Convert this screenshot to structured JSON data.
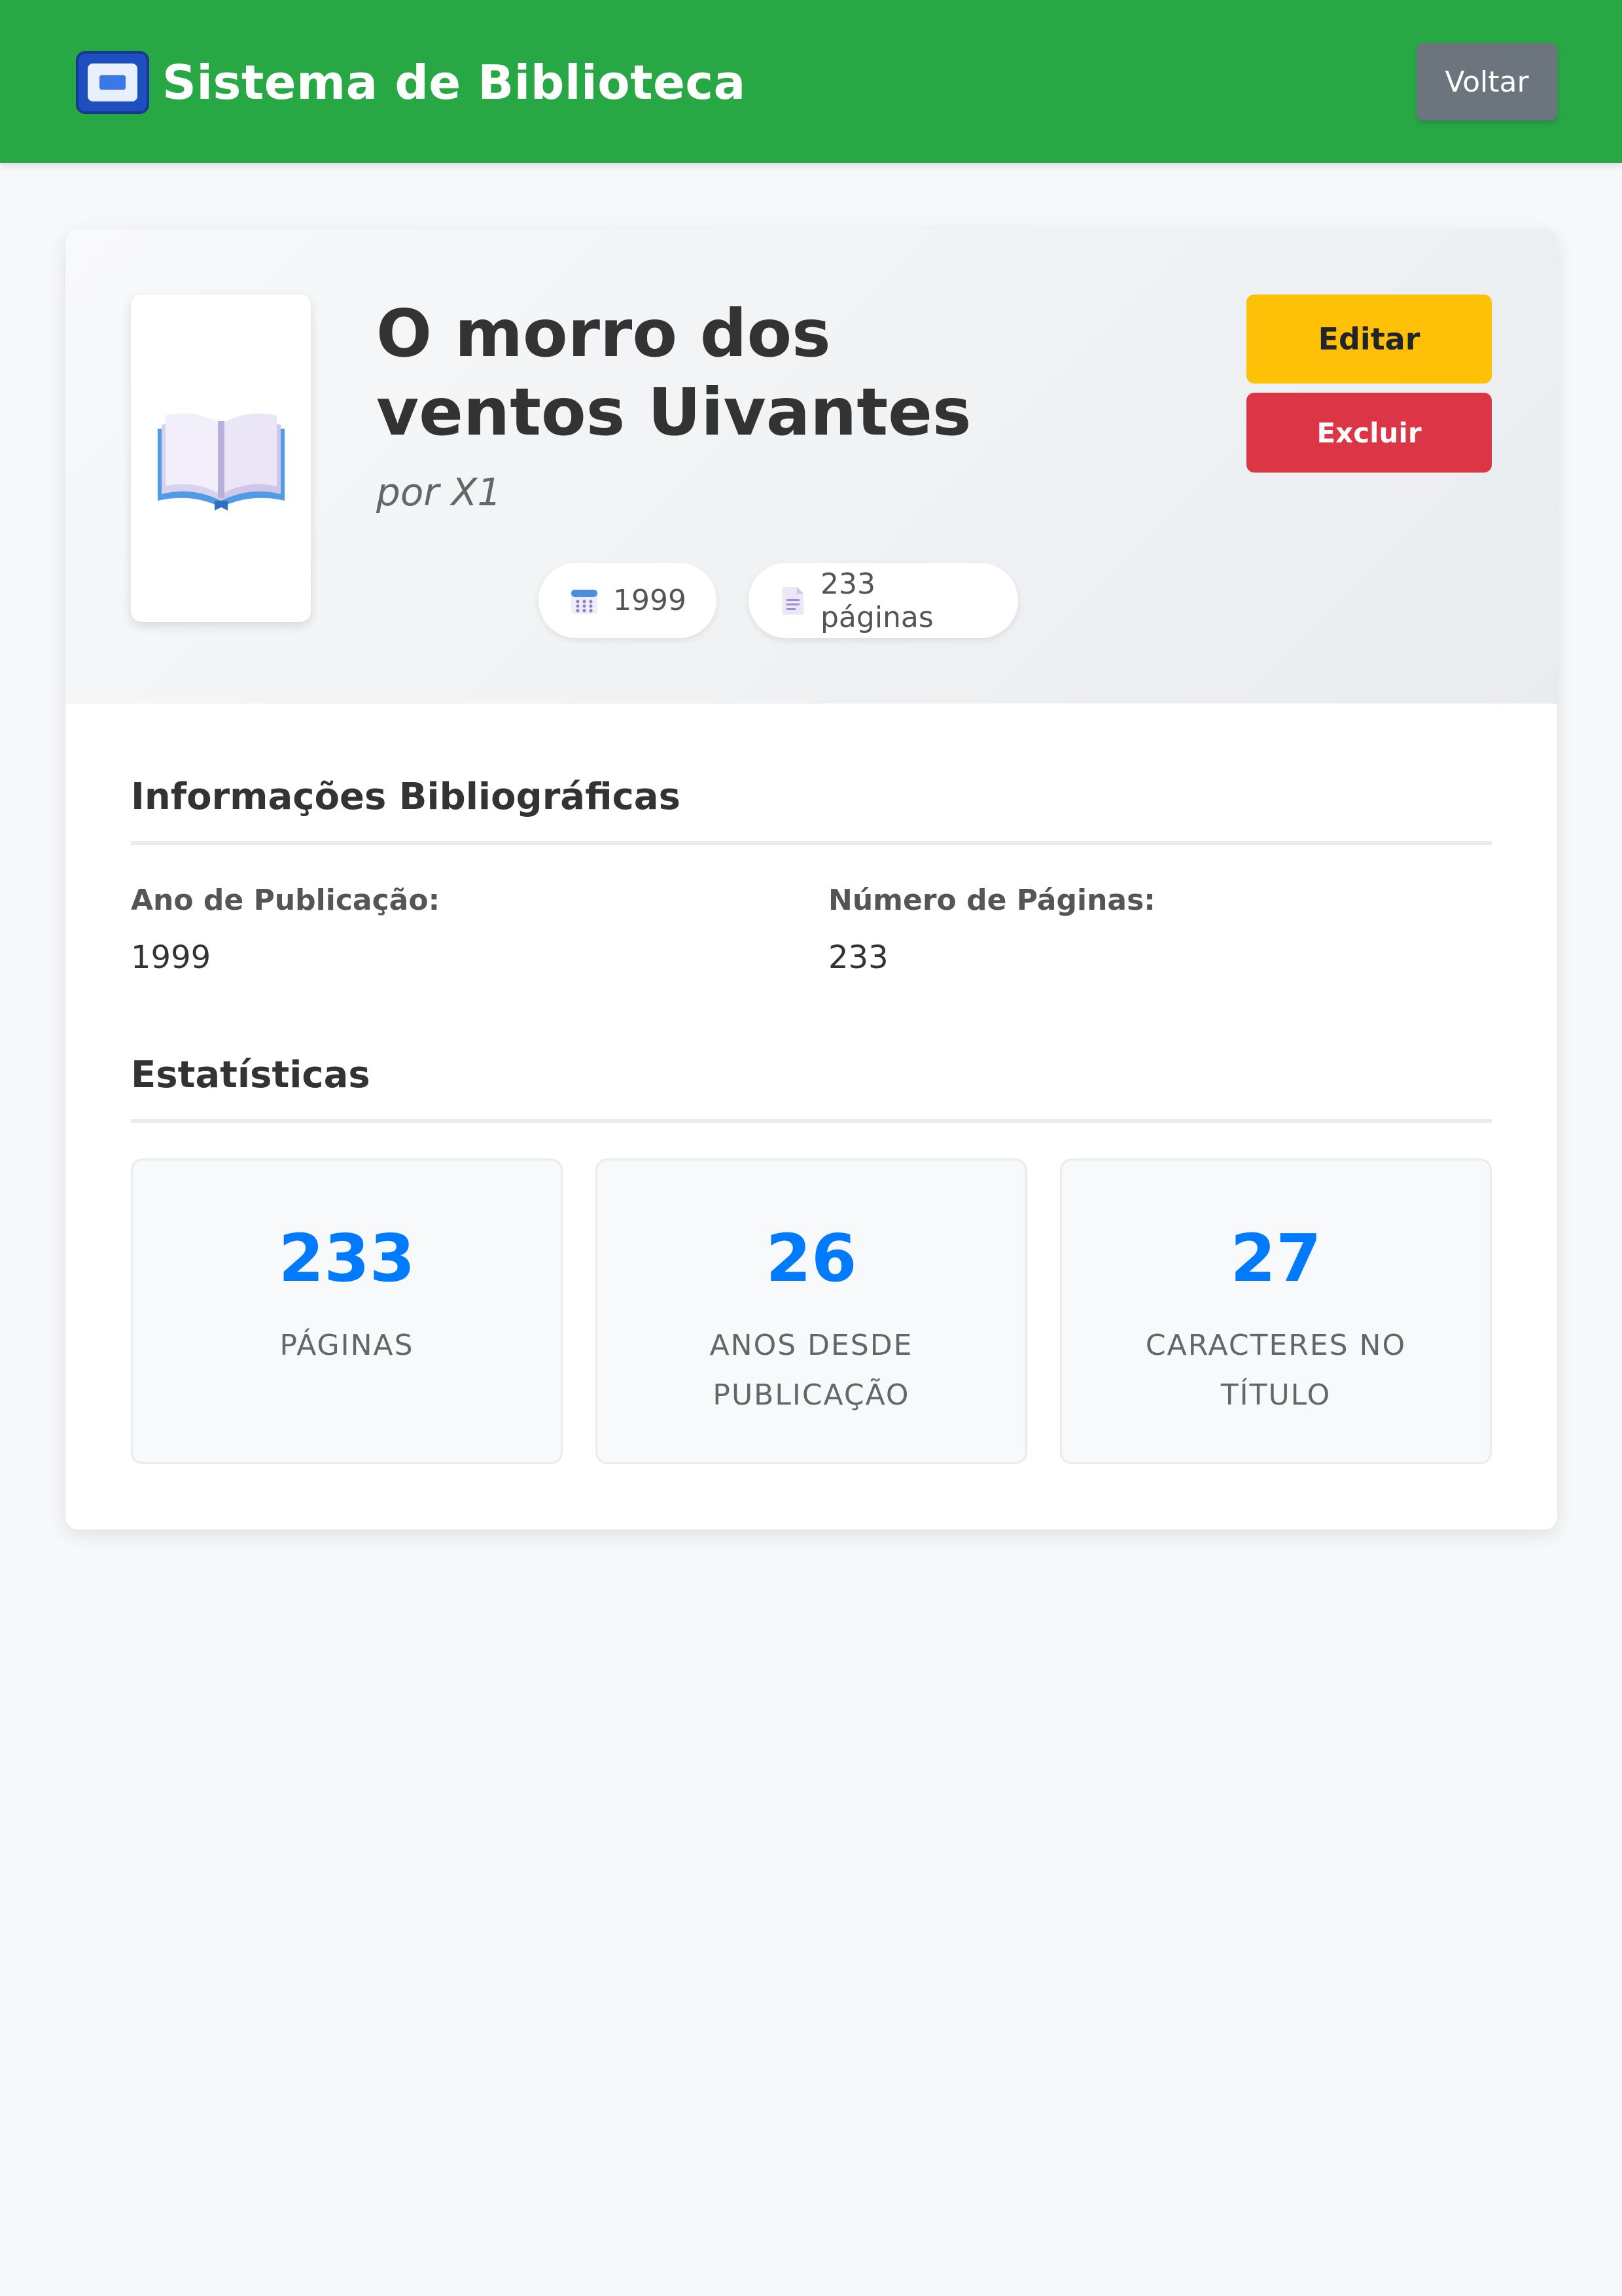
{
  "header": {
    "brand_title": "Sistema de Biblioteca",
    "brand_icon": "computer-window-icon",
    "back_label": "Voltar",
    "background_color": "#28a745"
  },
  "book": {
    "cover_icon": "open-book-icon",
    "title": "O morro dos ventos Uivantes",
    "author_line": "por X1",
    "year_pill": "1999",
    "year_icon": "calendar-icon",
    "pages_pill": "233 páginas",
    "pages_icon": "page-icon"
  },
  "actions": {
    "edit_label": "Editar",
    "edit_color": "#ffc107",
    "delete_label": "Excluir",
    "delete_color": "#dc3545"
  },
  "bibliographic": {
    "title": "Informações Bibliográficas",
    "year_label": "Ano de Publicação:",
    "year_value": "1999",
    "pages_label": "Número de Páginas:",
    "pages_value": "233"
  },
  "statistics": {
    "title": "Estatísticas",
    "accent_color": "#007bff",
    "items": [
      {
        "value": "233",
        "label": "Páginas"
      },
      {
        "value": "26",
        "label": "Anos desde publicação"
      },
      {
        "value": "27",
        "label": "Caracteres no título"
      }
    ]
  }
}
